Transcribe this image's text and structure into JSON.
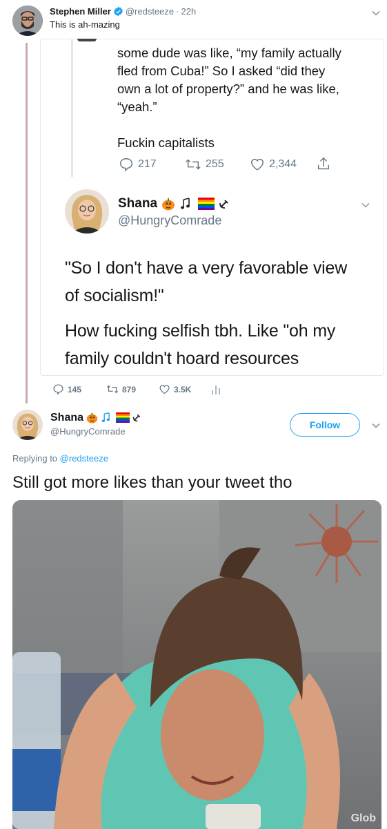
{
  "top_tweet": {
    "display_name": "Stephen Miller",
    "handle": "@redsteeze",
    "separator": "·",
    "time": "22h",
    "text": "This is ah-mazing"
  },
  "quoted_tweet": {
    "lines": [
      "some dude was like, “my family actually",
      "fled from Cuba!” So I asked “did they",
      "own a lot of property?” and he was like,",
      "“yeah.”"
    ],
    "punchline": "Fuckin capitalists",
    "stats": {
      "replies": "217",
      "retweets": "255",
      "likes": "2,344"
    }
  },
  "embedded_reply": {
    "display_name": "Shana",
    "handle": "@HungryComrade",
    "text_line1": "\"So I don't have a very favorable view",
    "text_line2": "of socialism!\"",
    "text_line3": "How fucking selfish tbh. Like \"oh my",
    "text_line4": "family couldn't hoard resources",
    "stats": {
      "replies": "145",
      "retweets": "879",
      "likes": "3.5K"
    }
  },
  "reply_tweet": {
    "display_name": "Shana",
    "handle": "@HungryComrade",
    "follow_label": "Follow",
    "replying_prefix": "Replying to ",
    "replying_handle": "@redsteeze",
    "text": "Still got more likes than your tweet tho",
    "gif_watermark": "Glob"
  },
  "colors": {
    "accent": "#1da1f2",
    "muted": "#657786",
    "border": "#e1e8ed",
    "thread_line": "#c9a9ad"
  },
  "icons": [
    "chevron-down-icon",
    "verified-badge-icon",
    "reply-icon",
    "retweet-icon",
    "like-icon",
    "share-icon",
    "analytics-icon",
    "pumpkin-emoji",
    "music-notes-emoji",
    "rainbow-flag-emoji",
    "hammer-sickle-emoji"
  ]
}
